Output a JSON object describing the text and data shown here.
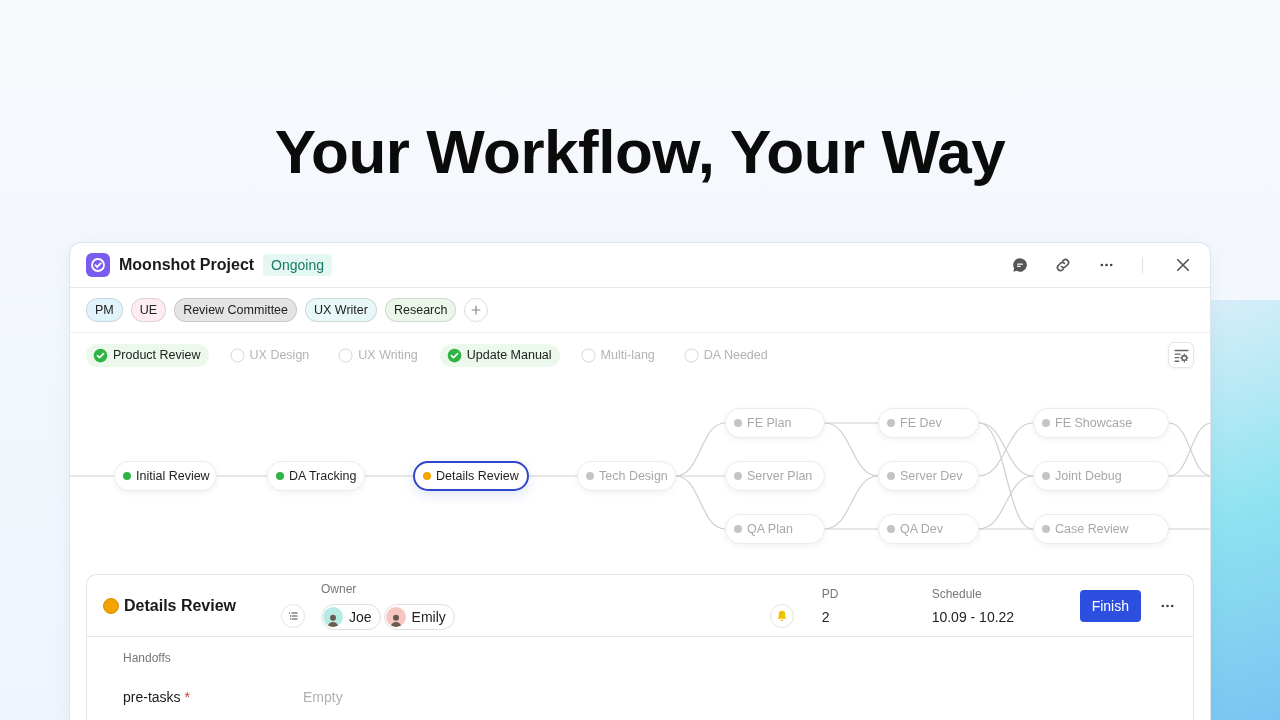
{
  "headline": "Your Workflow, Your Way",
  "project": {
    "title": "Moonshot Project",
    "status": "Ongoing"
  },
  "roles": [
    {
      "label": "PM",
      "color": "#e2f4fb"
    },
    {
      "label": "UE",
      "color": "#fdedf1"
    },
    {
      "label": "Review Committee",
      "color": "#e4e4e6"
    },
    {
      "label": "UX Writer",
      "color": "#e8f7f7"
    },
    {
      "label": "Research",
      "color": "#ecf7ec"
    }
  ],
  "steps": [
    {
      "label": "Product Review",
      "checked": true
    },
    {
      "label": "UX Design",
      "checked": false
    },
    {
      "label": "UX Writing",
      "checked": false
    },
    {
      "label": "Update Manual",
      "checked": true
    },
    {
      "label": "Multi-lang",
      "checked": false
    },
    {
      "label": "DA Needed",
      "checked": false
    }
  ],
  "flow": {
    "nodes": [
      {
        "label": "Initial Review",
        "color": "#2fb344",
        "disabled": false,
        "selected": false
      },
      {
        "label": "DA Tracking",
        "color": "#2fb344",
        "disabled": false,
        "selected": false
      },
      {
        "label": "Details Review",
        "color": "#f5a300",
        "disabled": false,
        "selected": true
      },
      {
        "label": "Tech Design",
        "color": "#c4c4c4",
        "disabled": true,
        "selected": false
      },
      {
        "label": "FE Plan",
        "color": "#c4c4c4",
        "disabled": true,
        "selected": false
      },
      {
        "label": "Server Plan",
        "color": "#c4c4c4",
        "disabled": true,
        "selected": false
      },
      {
        "label": "QA Plan",
        "color": "#c4c4c4",
        "disabled": true,
        "selected": false
      },
      {
        "label": "FE Dev",
        "color": "#c4c4c4",
        "disabled": true,
        "selected": false
      },
      {
        "label": "Server Dev",
        "color": "#c4c4c4",
        "disabled": true,
        "selected": false
      },
      {
        "label": "QA Dev",
        "color": "#c4c4c4",
        "disabled": true,
        "selected": false
      },
      {
        "label": "FE Showcase",
        "color": "#c4c4c4",
        "disabled": true,
        "selected": false
      },
      {
        "label": "Joint Debug",
        "color": "#c4c4c4",
        "disabled": true,
        "selected": false
      },
      {
        "label": "Case Review",
        "color": "#c4c4c4",
        "disabled": true,
        "selected": false
      }
    ]
  },
  "task": {
    "title": "Details Review",
    "color": "#f5a300",
    "owner_label": "Owner",
    "owners": [
      {
        "name": "Joe",
        "color": "#b5ebe4"
      },
      {
        "name": "Emily",
        "color": "#f7c6c3"
      }
    ],
    "pd_label": "PD",
    "pd": "2",
    "schedule_label": "Schedule",
    "schedule": "10.09 - 10.22",
    "action": "Finish",
    "section": "Handoffs",
    "fields": [
      {
        "label": "pre-tasks",
        "required_mark": "*",
        "placeholder": "Empty"
      }
    ]
  }
}
